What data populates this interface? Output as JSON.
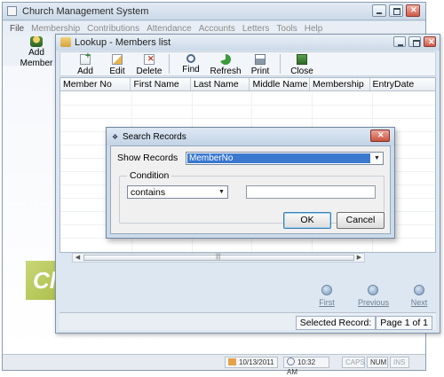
{
  "main_window": {
    "title": "Church Management System",
    "menu": [
      {
        "label": "File",
        "disabled": false
      },
      {
        "label": "Membership",
        "disabled": true
      },
      {
        "label": "Contributions",
        "disabled": true
      },
      {
        "label": "Attendance",
        "disabled": true
      },
      {
        "label": "Accounts",
        "disabled": true
      },
      {
        "label": "Letters",
        "disabled": true
      },
      {
        "label": "Tools",
        "disabled": true
      },
      {
        "label": "Help",
        "disabled": true
      }
    ],
    "toolbar": {
      "add_member_label": "Add Member"
    },
    "logo_text": "Cl"
  },
  "statusbar": {
    "date": "10/13/2011",
    "time": "10:32 AM",
    "caps": "CAPS",
    "num": "NUM",
    "ins": "INS"
  },
  "lookup": {
    "title": "Lookup - Members list",
    "toolbar": {
      "add": "Add",
      "edit": "Edit",
      "delete": "Delete",
      "find": "Find",
      "refresh": "Refresh",
      "print": "Print",
      "close": "Close"
    },
    "columns": [
      "Member No",
      "First Name",
      "Last Name",
      "Middle Name",
      "Membership",
      "EntryDate"
    ],
    "rows": [],
    "navigation": {
      "first": "First",
      "previous": "Previous",
      "next": "Next"
    },
    "status": {
      "label": "Selected Record:",
      "page": "Page 1 of 1"
    }
  },
  "search_dialog": {
    "title": "Search Records",
    "show_records_label": "Show Records",
    "show_records_value": "MemberNo",
    "condition_label": "Condition",
    "condition_value": "contains",
    "search_value": "",
    "ok_label": "OK",
    "cancel_label": "Cancel"
  }
}
